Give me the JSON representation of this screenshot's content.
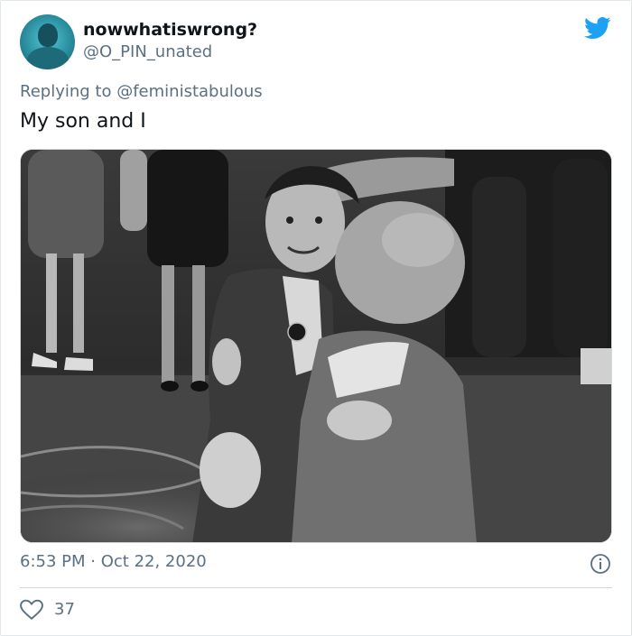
{
  "author": {
    "display_name": "nowwhatiswrong?",
    "handle": "@O_PIN_unated",
    "avatar_icon": "user-avatar"
  },
  "reply": {
    "prefix": "Replying to",
    "mention": "@feministabulous"
  },
  "tweet": {
    "text": "My son and I",
    "photo_icon": "photo-father-hugging-son"
  },
  "meta": {
    "time": "6:53 PM",
    "separator": "·",
    "date": "Oct 22, 2020"
  },
  "engagement": {
    "likes": "37"
  },
  "colors": {
    "twitter_blue": "#1da1f2",
    "secondary_text": "#5b7083",
    "divider": "#cfd9de"
  }
}
